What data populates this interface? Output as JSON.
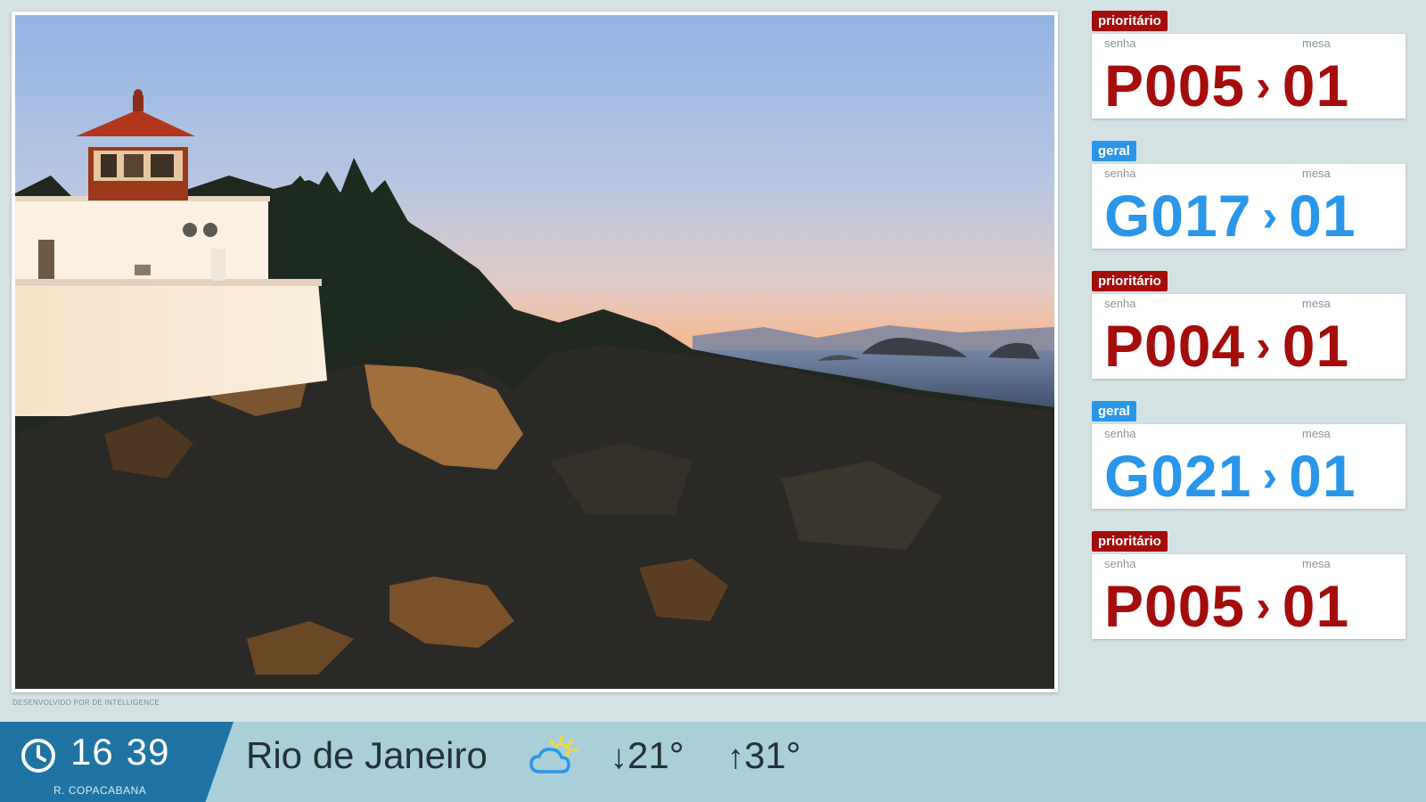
{
  "media": {
    "credit": "DESENVOLVIDO POR DE INTELLIGENCE"
  },
  "calls": [
    {
      "type_label": "prioritário",
      "kind": "prio",
      "senha_label": "senha",
      "mesa_label": "mesa",
      "ticket": "P005",
      "mesa": "01"
    },
    {
      "type_label": "geral",
      "kind": "geral",
      "senha_label": "senha",
      "mesa_label": "mesa",
      "ticket": "G017",
      "mesa": "01"
    },
    {
      "type_label": "prioritário",
      "kind": "prio",
      "senha_label": "senha",
      "mesa_label": "mesa",
      "ticket": "P004",
      "mesa": "01"
    },
    {
      "type_label": "geral",
      "kind": "geral",
      "senha_label": "senha",
      "mesa_label": "mesa",
      "ticket": "G021",
      "mesa": "01"
    },
    {
      "type_label": "prioritário",
      "kind": "prio",
      "senha_label": "senha",
      "mesa_label": "mesa",
      "ticket": "P005",
      "mesa": "01"
    }
  ],
  "colors": {
    "prioritario": "#a50d0d",
    "geral": "#2a96ea"
  },
  "footer": {
    "hour": "16",
    "minute": "39",
    "location": "R. COPACABANA",
    "city": "Rio de Janeiro",
    "weather_icon": "partly-cloudy-icon",
    "temp_min": "21°",
    "temp_max": "31°"
  }
}
